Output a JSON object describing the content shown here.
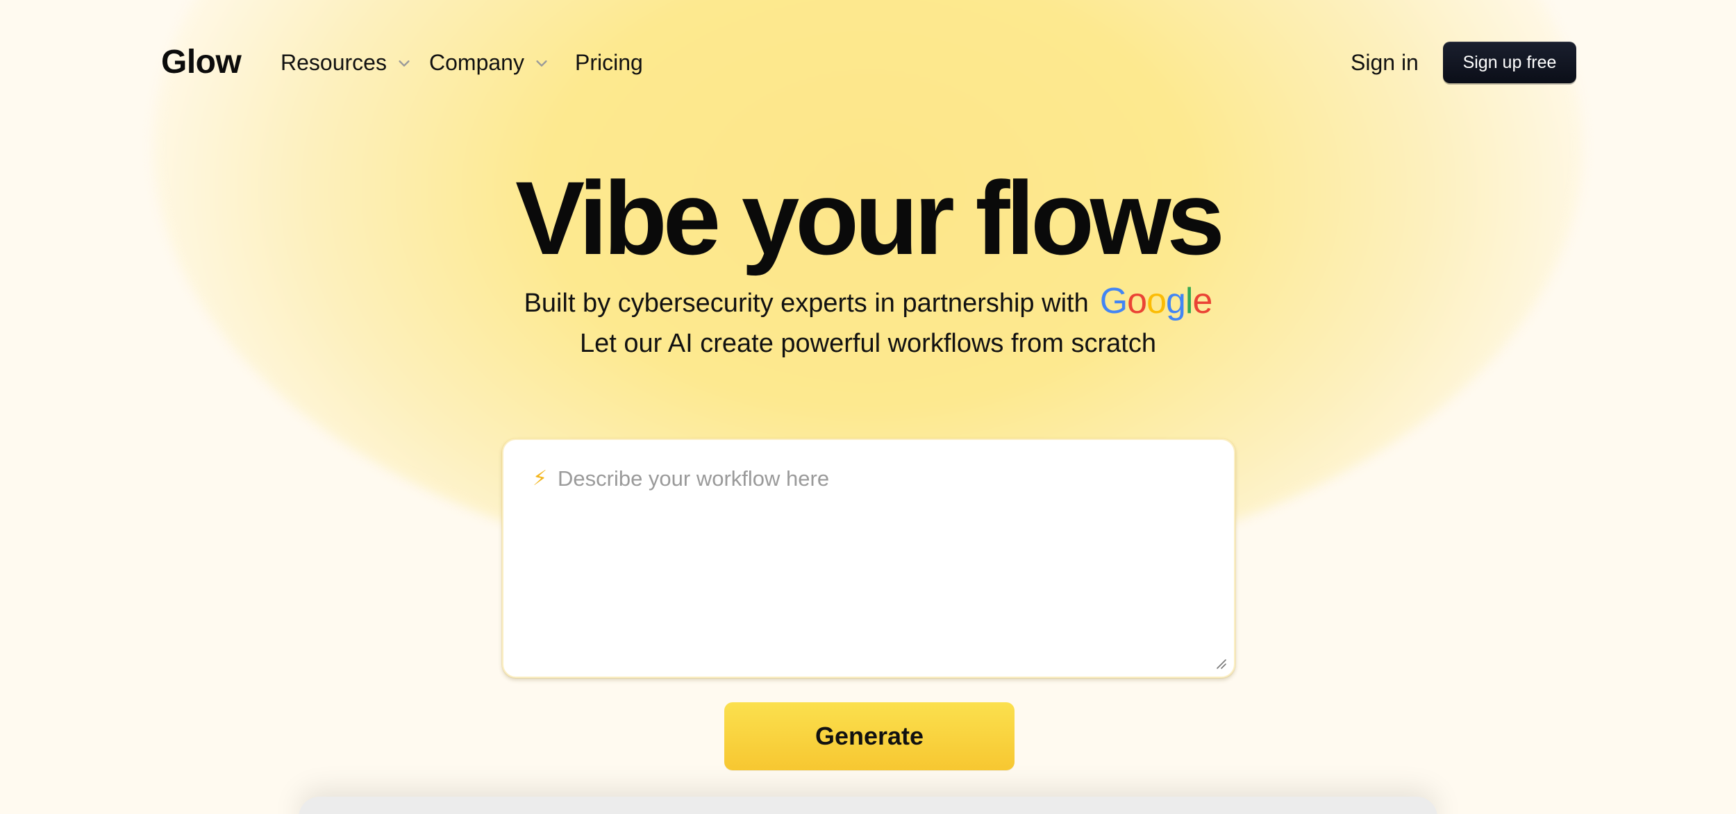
{
  "brand": {
    "logo": "Glow"
  },
  "nav": {
    "items": [
      {
        "label": "Resources",
        "has_dropdown": true
      },
      {
        "label": "Company",
        "has_dropdown": true
      },
      {
        "label": "Pricing",
        "has_dropdown": false
      }
    ],
    "sign_in": "Sign in",
    "sign_up": "Sign up free"
  },
  "hero": {
    "title": "Vibe your flows",
    "subtitle_line1": "Built by cybersecurity experts in partnership with",
    "partner_logo": "Google",
    "subtitle_line2": "Let our AI create powerful workflows from scratch"
  },
  "prompt": {
    "placeholder": "Describe your workflow here",
    "value": "",
    "icon": "lightning-bolt-icon"
  },
  "generate_label": "Generate",
  "colors": {
    "accent_yellow": "#f9d443",
    "background": "#fffaf0",
    "dark_button": "#0f1320",
    "google_blue": "#4285F4",
    "google_red": "#EA4335",
    "google_yellow": "#FBBC05",
    "google_green": "#34A853"
  }
}
